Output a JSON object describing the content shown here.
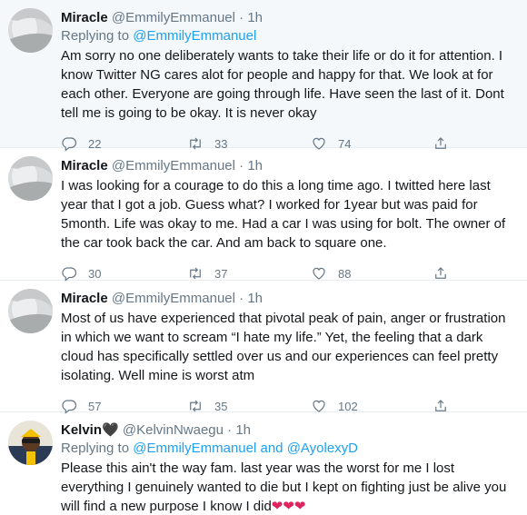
{
  "tweets": [
    {
      "name": "Miracle",
      "handle": "@EmmilyEmmanuel",
      "sep": "·",
      "time": "1h",
      "replying_label": "Replying to",
      "replying_to": "@EmmilyEmmanuel",
      "text": "Am sorry no one deliberately wants to take their life or do it for attention. I know Twitter NG cares alot for people and happy for that. We look at for each other. Everyone are going through life. Have seen the last of it. Dont tell me is going to be okay. It is never okay",
      "replies": "22",
      "retweets": "33",
      "likes": "74"
    },
    {
      "name": "Miracle",
      "handle": "@EmmilyEmmanuel",
      "sep": "·",
      "time": "1h",
      "text": "I was looking for a courage to do this a long time ago. I twitted here last year that I got a job. Guess what? I worked for 1year but was paid for 5month. Life was okay to me. Had a car I was using for bolt. The owner of the car took back the car. And am back to square one.",
      "replies": "30",
      "retweets": "37",
      "likes": "88"
    },
    {
      "name": "Miracle",
      "handle": "@EmmilyEmmanuel",
      "sep": "·",
      "time": "1h",
      "text": "Most of us have experienced that pivotal peak of pain, anger or frustration in which we want to scream “I hate my life.” Yet, the feeling that a dark cloud has specifically settled over us and our experiences can feel pretty isolating. Well mine is worst atm",
      "replies": "57",
      "retweets": "35",
      "likes": "102"
    },
    {
      "name": "Kelvin",
      "name_emoji": "🖤",
      "handle": "@KelvinNwaegu",
      "sep": "·",
      "time": "1h",
      "replying_label": "Replying to",
      "replying_to": "@EmmilyEmmanuel",
      "replying_and": "and",
      "replying_to_2": "@AyolexyD",
      "text": "Please this ain't the way fam. last year was the worst for me I lost everything I genuinely wanted to die but I kept on fighting just be alive you will find a new purpose I know I did",
      "text_emoji": "❤❤❤"
    }
  ],
  "icons": [
    "reply-icon",
    "retweet-icon",
    "like-icon",
    "share-icon"
  ],
  "colors": {
    "link": "#1da1f2",
    "muted": "#657786",
    "shaded_bg": "#f5f8fa",
    "heart": "#e0245e"
  }
}
